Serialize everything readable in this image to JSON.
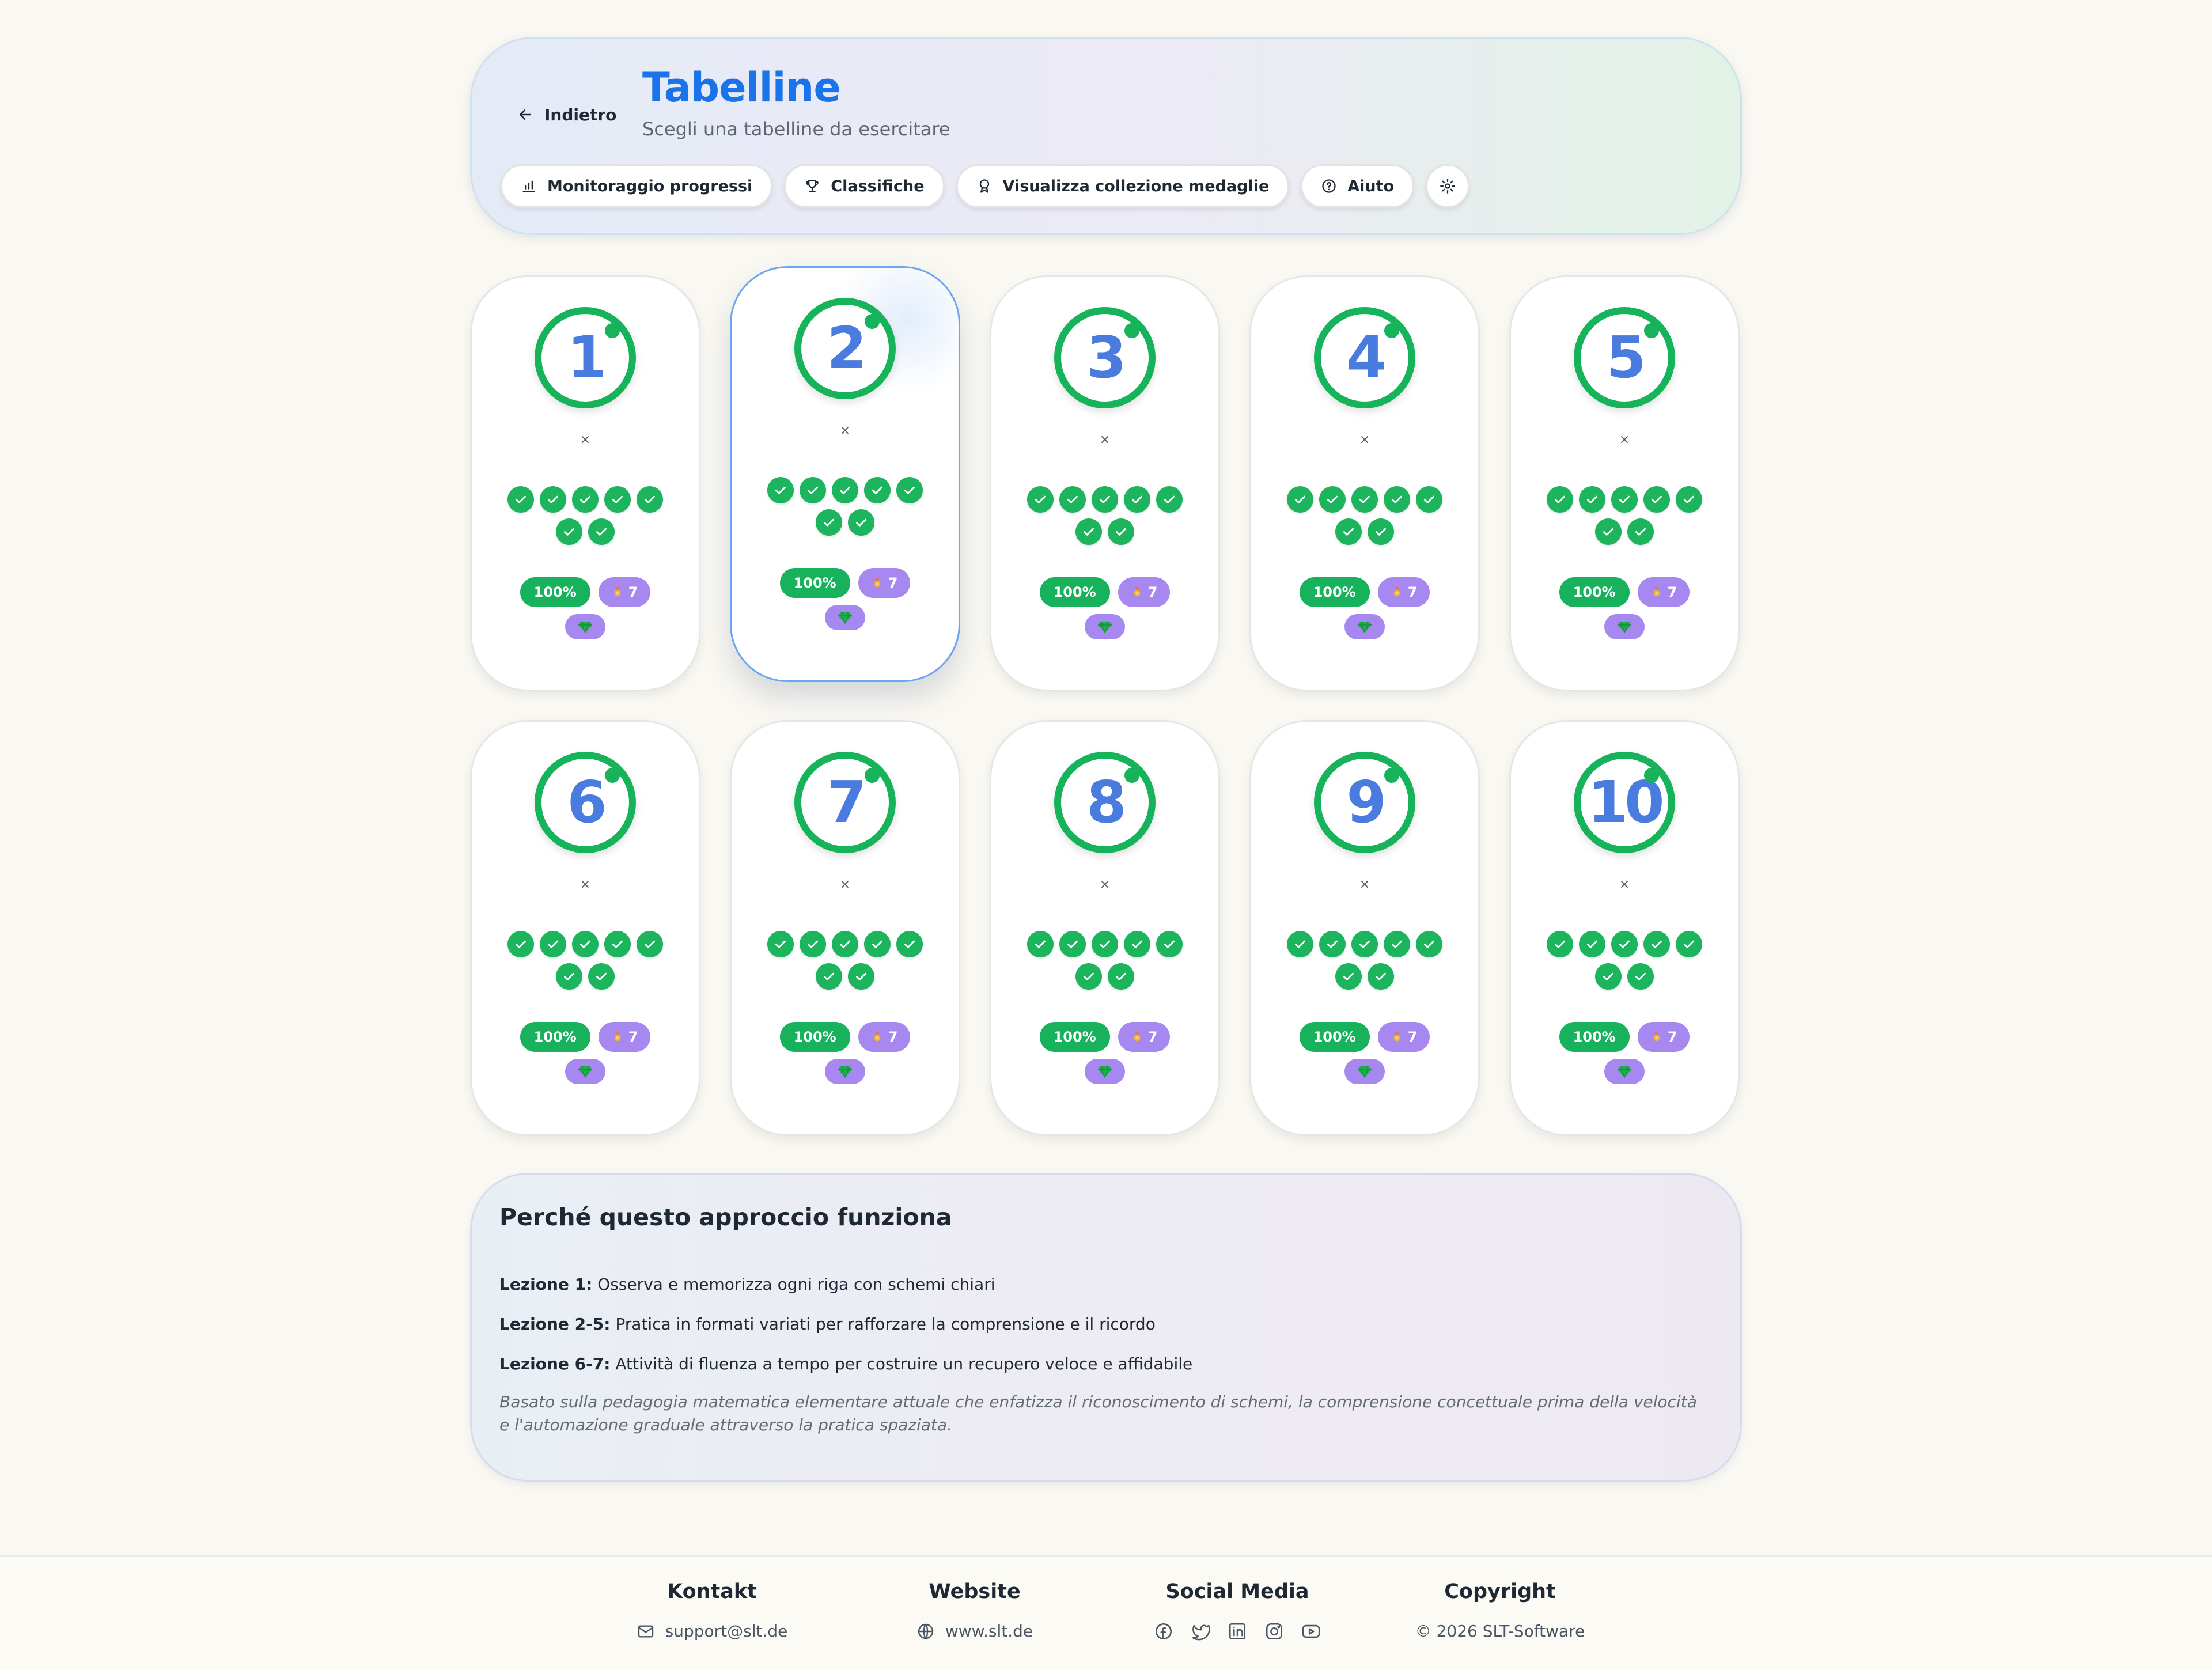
{
  "header": {
    "back_label": "Indietro",
    "title": "Tabelline",
    "subtitle": "Scegli una tabelline da esercitare",
    "buttons": {
      "progress": "Monitoraggio progressi",
      "leaderboards": "Classifiche",
      "medals": "Visualizza collezione medaglie",
      "help": "Aiuto"
    }
  },
  "tables": [
    {
      "number": "1",
      "times": "×",
      "completed_lessons": 7,
      "percent": "100%",
      "medals": "7"
    },
    {
      "number": "2",
      "times": "×",
      "completed_lessons": 7,
      "percent": "100%",
      "medals": "7"
    },
    {
      "number": "3",
      "times": "×",
      "completed_lessons": 7,
      "percent": "100%",
      "medals": "7"
    },
    {
      "number": "4",
      "times": "×",
      "completed_lessons": 7,
      "percent": "100%",
      "medals": "7"
    },
    {
      "number": "5",
      "times": "×",
      "completed_lessons": 7,
      "percent": "100%",
      "medals": "7"
    },
    {
      "number": "6",
      "times": "×",
      "completed_lessons": 7,
      "percent": "100%",
      "medals": "7"
    },
    {
      "number": "7",
      "times": "×",
      "completed_lessons": 7,
      "percent": "100%",
      "medals": "7"
    },
    {
      "number": "8",
      "times": "×",
      "completed_lessons": 7,
      "percent": "100%",
      "medals": "7"
    },
    {
      "number": "9",
      "times": "×",
      "completed_lessons": 7,
      "percent": "100%",
      "medals": "7"
    },
    {
      "number": "10",
      "times": "×",
      "completed_lessons": 7,
      "percent": "100%",
      "medals": "7"
    }
  ],
  "selected_table": "2",
  "info": {
    "title": "Perché questo approccio funziona",
    "lines": [
      {
        "label": "Lezione 1:",
        "text": "Osserva e memorizza ogni riga con schemi chiari"
      },
      {
        "label": "Lezione 2-5:",
        "text": "Pratica in formati variati per rafforzare la comprensione e il ricordo"
      },
      {
        "label": "Lezione 6-7:",
        "text": "Attività di fluenza a tempo per costruire un recupero veloce e affidabile"
      }
    ],
    "note": "Basato sulla pedagogia matematica elementare attuale che enfatizza il riconoscimento di schemi, la comprensione concettuale prima della velocità e l'automazione graduale attraverso la pratica spaziata."
  },
  "footer": {
    "contact": {
      "heading": "Kontakt",
      "value": "support@slt.de"
    },
    "website": {
      "heading": "Website",
      "value": "www.slt.de"
    },
    "social": {
      "heading": "Social Media",
      "icons": [
        "facebook-icon",
        "twitter-icon",
        "linkedin-icon",
        "instagram-icon",
        "youtube-icon"
      ]
    },
    "copyright": {
      "heading": "Copyright",
      "value": "© 2026 SLT-Software"
    }
  },
  "colors": {
    "accent": "#1a73e8",
    "number": "#4a7bdf",
    "success": "#16b35a",
    "medal": "#a688f0",
    "gem": "#1fae4b",
    "background": "#faf8f2"
  }
}
